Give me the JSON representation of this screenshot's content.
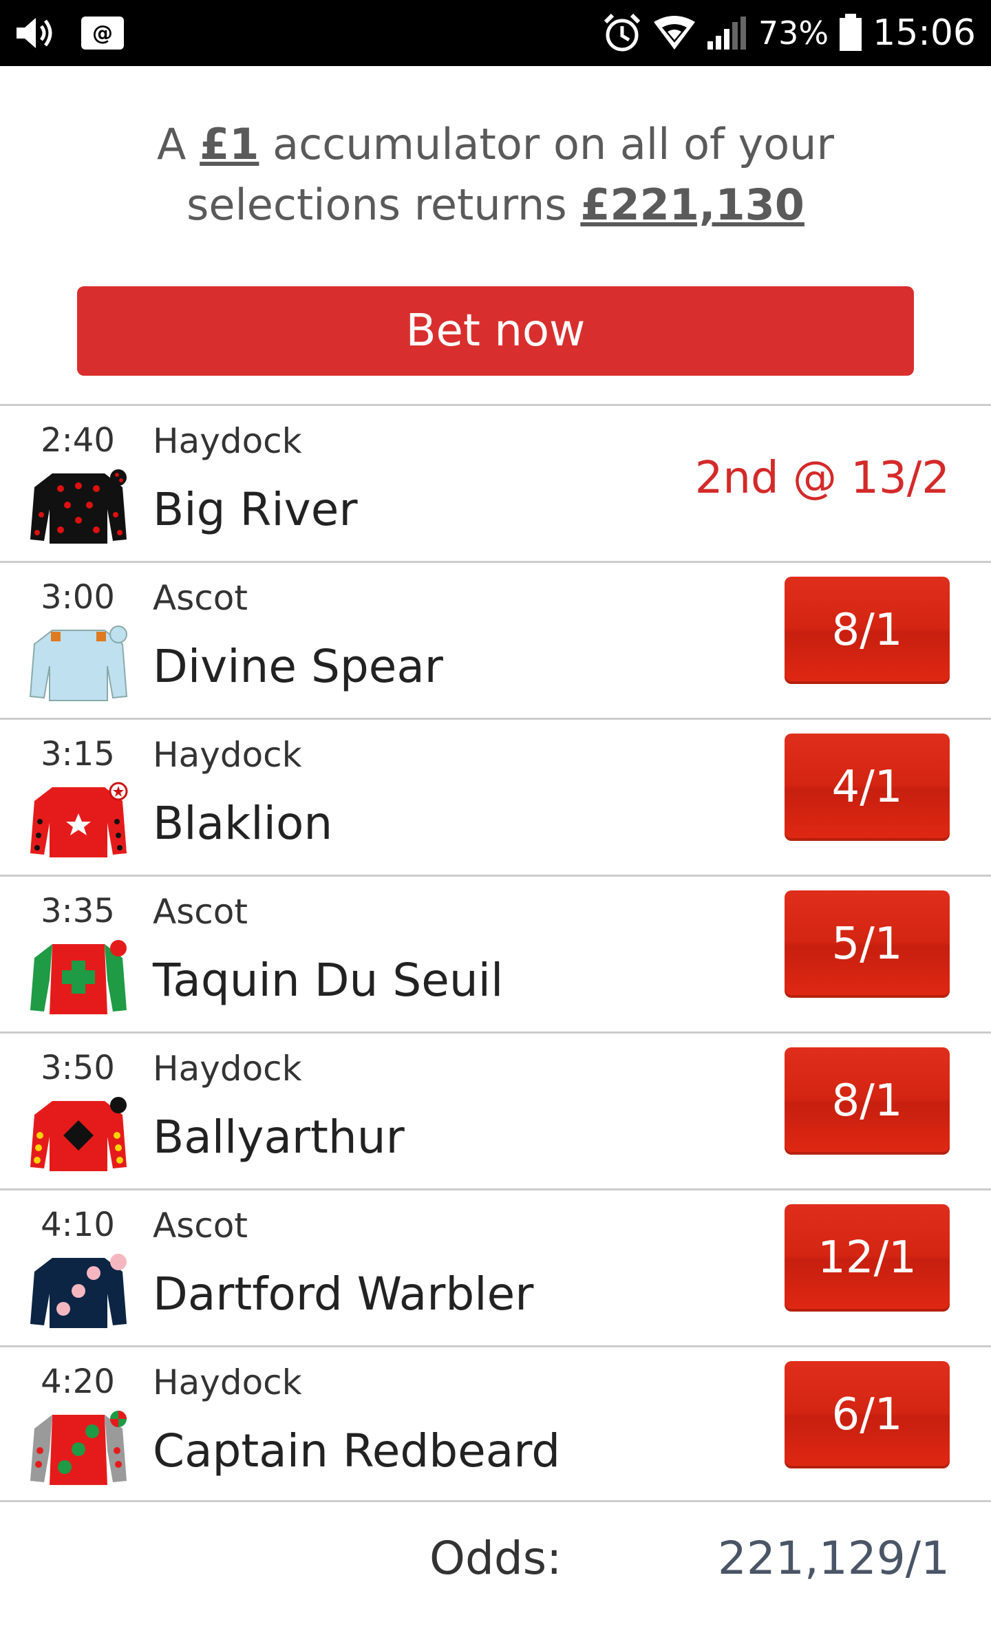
{
  "status_bar": {
    "icons": [
      "volume-icon",
      "at-notification-icon",
      "alarm-icon",
      "wifi-icon",
      "signal-icon",
      "battery-icon"
    ],
    "at_label": "@",
    "battery": "73%",
    "time": "15:06"
  },
  "promo": {
    "text_1": "A ",
    "stake": "£1",
    "text_2": " accumulator on all of your selections returns ",
    "returns": "£221,130"
  },
  "bet_button": {
    "label": "Bet now"
  },
  "selections": [
    {
      "time": "2:40",
      "course": "Haydock",
      "horse": "Big River",
      "result": "2nd @ 13/2",
      "odds": ""
    },
    {
      "time": "3:00",
      "course": "Ascot",
      "horse": "Divine Spear",
      "odds": "8/1"
    },
    {
      "time": "3:15",
      "course": "Haydock",
      "horse": "Blaklion",
      "odds": "4/1"
    },
    {
      "time": "3:35",
      "course": "Ascot",
      "horse": "Taquin Du Seuil",
      "odds": "5/1"
    },
    {
      "time": "3:50",
      "course": "Haydock",
      "horse": "Ballyarthur",
      "odds": "8/1"
    },
    {
      "time": "4:10",
      "course": "Ascot",
      "horse": "Dartford Warbler",
      "odds": "12/1"
    },
    {
      "time": "4:20",
      "course": "Haydock",
      "horse": "Captain Redbeard",
      "odds": "6/1"
    }
  ],
  "footer": {
    "odds_label": "Odds:",
    "odds_value": "221,129/1"
  },
  "colors": {
    "accent_red": "#d82f2e",
    "odds_button_red": "#d42412",
    "result_red": "#d42a2a",
    "status_bar": "#000000"
  }
}
